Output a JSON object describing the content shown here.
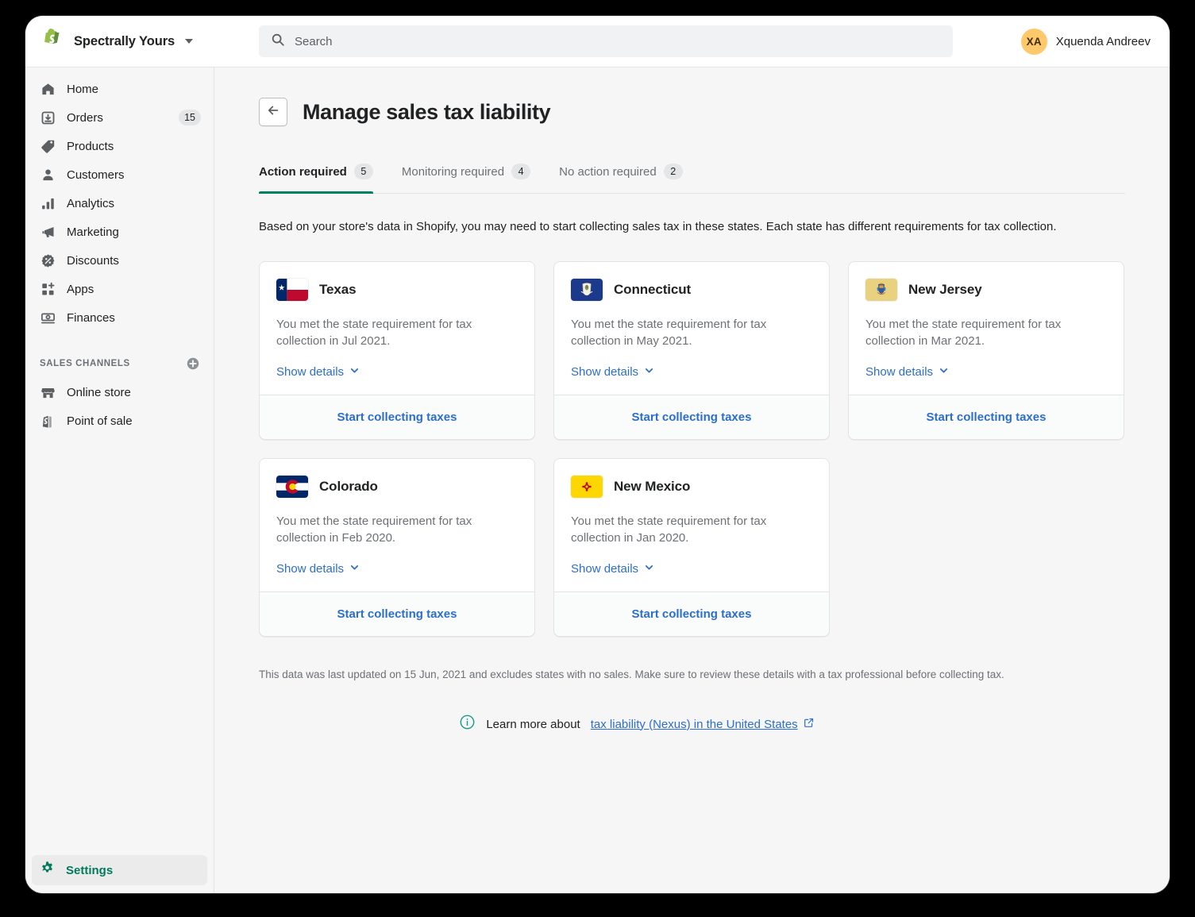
{
  "topbar": {
    "store_name": "Spectrally Yours",
    "store_switcher_icon": "shopify-logo",
    "search_placeholder": "Search",
    "search_icon": "search-icon",
    "user": {
      "initials": "XA",
      "name": "Xquenda Andreev"
    }
  },
  "sidebar": {
    "items": [
      {
        "label": "Home",
        "icon": "home-icon",
        "badge": ""
      },
      {
        "label": "Orders",
        "icon": "orders-inbox-icon",
        "badge": "15"
      },
      {
        "label": "Products",
        "icon": "tag-icon",
        "badge": ""
      },
      {
        "label": "Customers",
        "icon": "person-icon",
        "badge": ""
      },
      {
        "label": "Analytics",
        "icon": "bar-chart-icon",
        "badge": ""
      },
      {
        "label": "Marketing",
        "icon": "megaphone-icon",
        "badge": ""
      },
      {
        "label": "Discounts",
        "icon": "discount-percent-icon",
        "badge": ""
      },
      {
        "label": "Apps",
        "icon": "apps-grid-plus-icon",
        "badge": ""
      },
      {
        "label": "Finances",
        "icon": "banknote-icon",
        "badge": ""
      }
    ],
    "section": {
      "title": "SALES CHANNELS",
      "add_icon": "circle-plus-icon",
      "items": [
        {
          "label": "Online store",
          "icon": "storefront-icon"
        },
        {
          "label": "Point of sale",
          "icon": "pos-bag-icon"
        }
      ]
    },
    "settings": {
      "label": "Settings",
      "icon": "gear-icon"
    }
  },
  "page": {
    "back_icon": "arrow-left-icon",
    "title": "Manage sales tax liability",
    "tabs": [
      {
        "label": "Action required",
        "count": "5",
        "active": true
      },
      {
        "label": "Monitoring required",
        "count": "4",
        "active": false
      },
      {
        "label": "No action required",
        "count": "2",
        "active": false
      }
    ],
    "intro": "Based on your store's data in Shopify, you may need to start collecting sales tax in these states. Each state has different requirements for tax collection.",
    "cards": [
      {
        "state": "Texas",
        "flag": "flag-texas",
        "description": "You met the state requirement for tax collection in Jul 2021.",
        "show_details_label": "Show details",
        "show_details_icon": "chevron-down-icon",
        "action_label": "Start collecting taxes"
      },
      {
        "state": "Connecticut",
        "flag": "flag-connecticut",
        "description": "You met the state requirement for tax collection in May 2021.",
        "show_details_label": "Show details",
        "show_details_icon": "chevron-down-icon",
        "action_label": "Start collecting taxes"
      },
      {
        "state": "New Jersey",
        "flag": "flag-new-jersey",
        "description": "You met the state requirement for tax collection in Mar 2021.",
        "show_details_label": "Show details",
        "show_details_icon": "chevron-down-icon",
        "action_label": "Start collecting taxes"
      },
      {
        "state": "Colorado",
        "flag": "flag-colorado",
        "description": "You met the state requirement for tax collection in Feb 2020.",
        "show_details_label": "Show details",
        "show_details_icon": "chevron-down-icon",
        "action_label": "Start collecting taxes"
      },
      {
        "state": "New Mexico",
        "flag": "flag-new-mexico",
        "description": "You met the state requirement for tax collection in Jan 2020.",
        "show_details_label": "Show details",
        "show_details_icon": "chevron-down-icon",
        "action_label": "Start collecting taxes"
      }
    ],
    "footnote": "This data was last updated on 15 Jun, 2021 and excludes states with no sales. Make sure to review these details with a tax professional before collecting tax.",
    "learn_more": {
      "info_icon": "info-circle-icon",
      "prefix": "Learn more about",
      "link_text": "tax liability (Nexus) in the United States",
      "external_icon": "external-link-icon"
    }
  },
  "colors": {
    "brand_green": "#008060",
    "settings_green": "#007b5c",
    "link_blue": "#2c6ecb",
    "sidebar_bg": "#f6f6f7",
    "avatar_bg": "#ffc96b",
    "badge_bg": "#e4e5e7"
  }
}
